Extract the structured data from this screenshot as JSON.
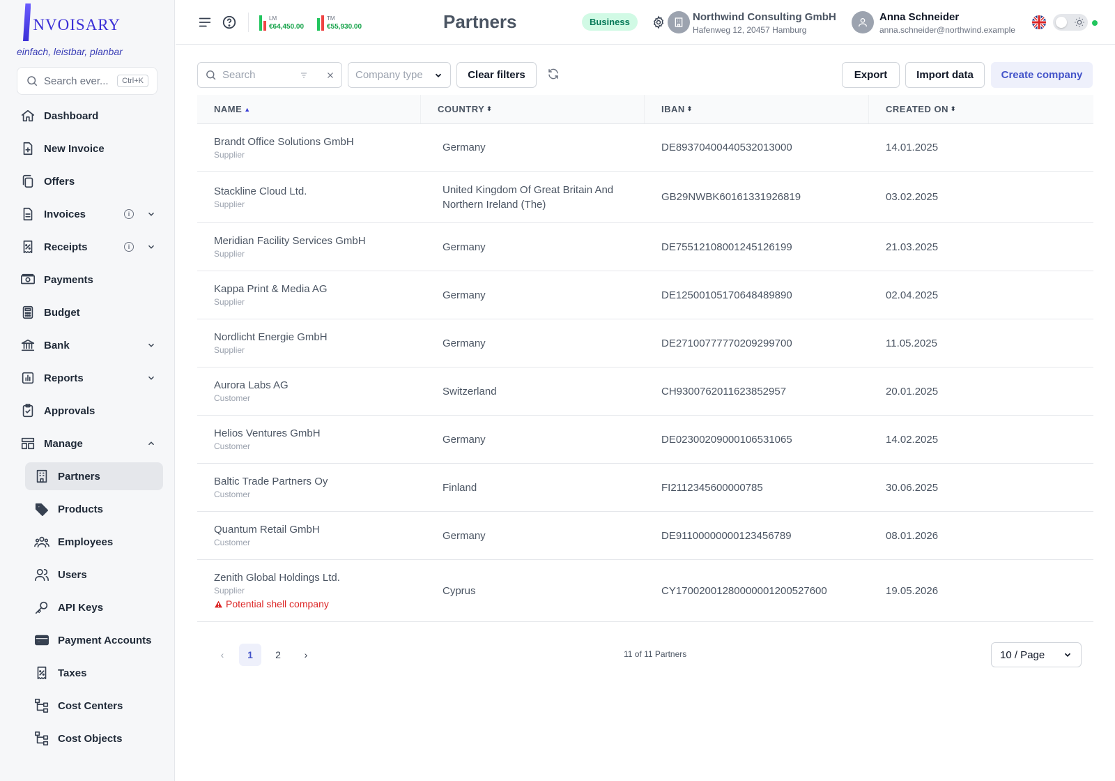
{
  "app": {
    "logo_text": "NVOISARY",
    "tagline": "einfach, leistbar, planbar"
  },
  "sidebar": {
    "search_placeholder": "Search ever...",
    "search_shortcut": "Ctrl+K",
    "items": [
      {
        "label": "Dashboard",
        "icon": "home-icon"
      },
      {
        "label": "New Invoice",
        "icon": "file-plus-icon"
      },
      {
        "label": "Offers",
        "icon": "copy-icon"
      },
      {
        "label": "Invoices",
        "icon": "file-icon",
        "info": true,
        "chevron": "down"
      },
      {
        "label": "Receipts",
        "icon": "receipt-icon",
        "info": true,
        "chevron": "down"
      },
      {
        "label": "Payments",
        "icon": "cash-icon"
      },
      {
        "label": "Budget",
        "icon": "calculator-icon"
      },
      {
        "label": "Bank",
        "icon": "bank-icon",
        "chevron": "down"
      },
      {
        "label": "Reports",
        "icon": "chart-icon",
        "chevron": "down"
      },
      {
        "label": "Approvals",
        "icon": "clipboard-check-icon"
      },
      {
        "label": "Manage",
        "icon": "layout-icon",
        "chevron": "up"
      }
    ],
    "subitems": [
      {
        "label": "Partners",
        "icon": "building-icon",
        "active": true
      },
      {
        "label": "Products",
        "icon": "tag-icon"
      },
      {
        "label": "Employees",
        "icon": "users-group-icon"
      },
      {
        "label": "Users",
        "icon": "users-icon"
      },
      {
        "label": "API Keys",
        "icon": "key-icon"
      },
      {
        "label": "Payment Accounts",
        "icon": "credit-card-icon"
      },
      {
        "label": "Taxes",
        "icon": "receipt-icon"
      },
      {
        "label": "Cost Centers",
        "icon": "hierarchy-icon"
      },
      {
        "label": "Cost Objects",
        "icon": "hierarchy-icon"
      }
    ]
  },
  "header": {
    "title": "Partners",
    "plan_badge": "Business",
    "kpi_last_month_label": "LM",
    "kpi_last_month_value": "€64,450.00",
    "kpi_this_month_label": "TM",
    "kpi_this_month_value": "€55,930.00",
    "company_name": "Northwind Consulting GmbH",
    "company_address": "Hafenweg 12, 20457 Hamburg",
    "user_name": "Anna Schneider",
    "user_email": "anna.schneider@northwind.example"
  },
  "toolbar": {
    "search_placeholder": "Search",
    "company_type_placeholder": "Company type",
    "clear_filters": "Clear filters",
    "export": "Export",
    "import": "Import data",
    "create": "Create company"
  },
  "table": {
    "columns": [
      "NAME",
      "COUNTRY",
      "IBAN",
      "CREATED ON"
    ],
    "rows": [
      {
        "name": "Brandt Office Solutions GmbH",
        "type": "Supplier",
        "country": "Germany",
        "iban": "DE89370400440532013000",
        "created": "14.01.2025"
      },
      {
        "name": "Stackline Cloud Ltd.",
        "type": "Supplier",
        "country": "United Kingdom Of Great Britain And Northern Ireland (The)",
        "iban": "GB29NWBK60161331926819",
        "created": "03.02.2025"
      },
      {
        "name": "Meridian Facility Services GmbH",
        "type": "Supplier",
        "country": "Germany",
        "iban": "DE75512108001245126199",
        "created": "21.03.2025"
      },
      {
        "name": "Kappa Print & Media AG",
        "type": "Supplier",
        "country": "Germany",
        "iban": "DE12500105170648489890",
        "created": "02.04.2025"
      },
      {
        "name": "Nordlicht Energie GmbH",
        "type": "Supplier",
        "country": "Germany",
        "iban": "DE27100777770209299700",
        "created": "11.05.2025"
      },
      {
        "name": "Aurora Labs AG",
        "type": "Customer",
        "country": "Switzerland",
        "iban": "CH9300762011623852957",
        "created": "20.01.2025"
      },
      {
        "name": "Helios Ventures GmbH",
        "type": "Customer",
        "country": "Germany",
        "iban": "DE02300209000106531065",
        "created": "14.02.2025"
      },
      {
        "name": "Baltic Trade Partners Oy",
        "type": "Customer",
        "country": "Finland",
        "iban": "FI2112345600000785",
        "created": "30.06.2025"
      },
      {
        "name": "Quantum Retail GmbH",
        "type": "Customer",
        "country": "Germany",
        "iban": "DE91100000000123456789",
        "created": "08.01.2026"
      },
      {
        "name": "Zenith Global Holdings Ltd.",
        "type": "Supplier",
        "country": "Cyprus",
        "iban": "CY17002001280000001200527600",
        "created": "19.05.2026",
        "warning": "Potential shell company"
      }
    ]
  },
  "pagination": {
    "pages": [
      "1",
      "2"
    ],
    "current": "1",
    "summary": "11 of 11 Partners",
    "page_size": "10 / Page"
  },
  "colors": {
    "accent": "#4353c9",
    "success": "#16a34a",
    "danger": "#dc2626"
  }
}
